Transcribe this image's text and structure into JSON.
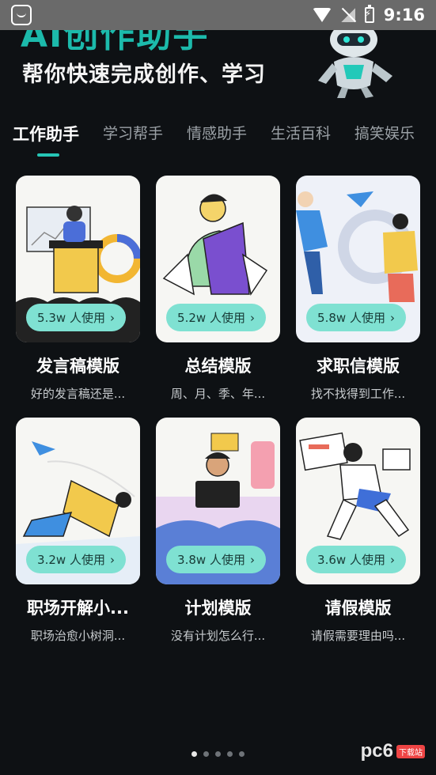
{
  "status_bar": {
    "time": "9:16"
  },
  "hero": {
    "title_cut": "AI创作助手",
    "subtitle": "帮你快速完成创作、学习"
  },
  "tabs": [
    {
      "label": "工作助手",
      "active": true
    },
    {
      "label": "学习帮手",
      "active": false
    },
    {
      "label": "情感助手",
      "active": false
    },
    {
      "label": "生活百科",
      "active": false
    },
    {
      "label": "搞笑娱乐",
      "active": false
    }
  ],
  "cards": [
    {
      "usage": "5.3w 人使用",
      "title": "发言稿模版",
      "desc": "好的发言稿还是..."
    },
    {
      "usage": "5.2w 人使用",
      "title": "总结模版",
      "desc": "周、月、季、年..."
    },
    {
      "usage": "5.8w 人使用",
      "title": "求职信模版",
      "desc": "找不找得到工作..."
    },
    {
      "usage": "3.2w 人使用",
      "title": "职场开解小...",
      "desc": "职场治愈小树洞..."
    },
    {
      "usage": "3.8w 人使用",
      "title": "计划模版",
      "desc": "没有计划怎么行..."
    },
    {
      "usage": "3.6w 人使用",
      "title": "请假模版",
      "desc": "请假需要理由吗..."
    }
  ],
  "pager": {
    "active_index": 0,
    "count": 5
  },
  "watermark": {
    "text": "pc6",
    "badge": "下载站"
  },
  "colors": {
    "accent": "#26c6b6",
    "pill": "#7fe1d2",
    "background": "#0e1114"
  }
}
